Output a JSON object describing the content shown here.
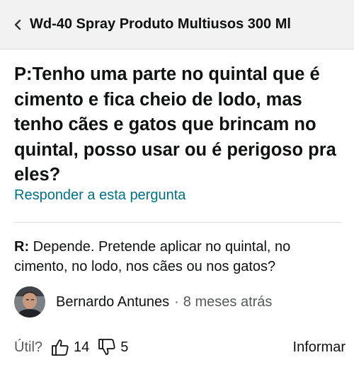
{
  "header": {
    "back_icon": "chevron-left-icon",
    "product_title": "Wd-40 Spray Produto Multiusos 300 Ml"
  },
  "question": {
    "text": "P:Tenho uma parte no quintal que é cimento e fica cheio de lodo, mas tenho cães e gatos que brincam no quintal, posso usar ou é perigoso pra eles?",
    "answer_link": "Responder a esta pergunta"
  },
  "answer": {
    "prefix": "R:",
    "text": " Depende. Pretende aplicar no quintal, no cimento, no lodo, nos cães ou nos gatos?",
    "author": "Bernardo Antunes",
    "separator": "·",
    "time": "8 meses atrás"
  },
  "votes": {
    "label": "Útil?",
    "up_icon": "thumbs-up-icon",
    "up_count": "14",
    "down_icon": "thumbs-down-icon",
    "down_count": "5",
    "report_label": "Informar"
  },
  "colors": {
    "link": "#007185",
    "header_bg": "#f2f2f2",
    "text": "#0f1111",
    "muted": "#565959"
  }
}
